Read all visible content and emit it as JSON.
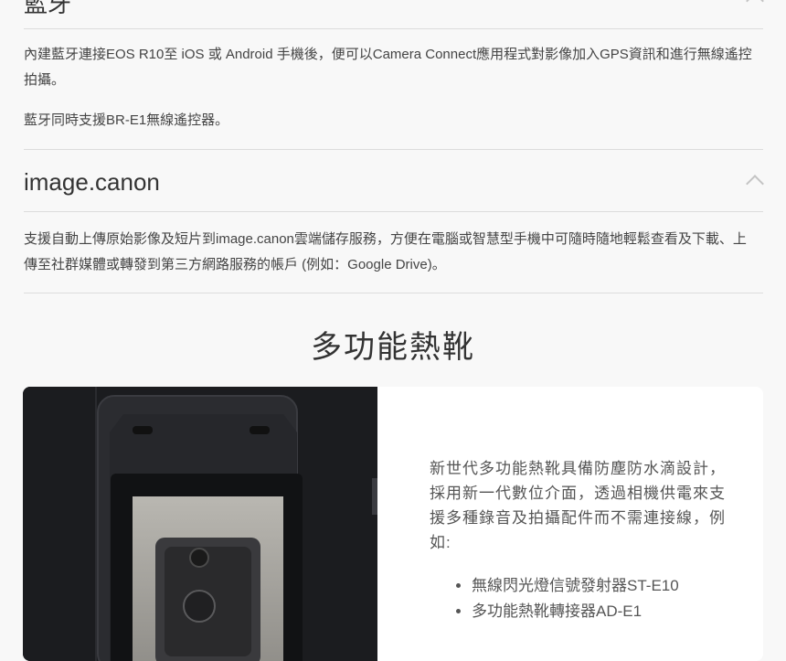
{
  "accordion": [
    {
      "title": "藍牙",
      "paragraphs": [
        "內建藍牙連接EOS R10至 iOS 或 Android 手機後，便可以Camera Connect應用程式對影像加入GPS資訊和進行無線遙控拍攝。",
        "藍牙同時支援BR-E1無線遙控器。"
      ]
    },
    {
      "title": "image.canon",
      "paragraphs": [
        "支援自動上傳原始影像及短片到image.canon雲端儲存服務，方便在電腦或智慧型手機中可隨時隨地輕鬆查看及下載、上傳至社群媒體或轉發到第三方網路服務的帳戶 (例如：Google Drive)。"
      ]
    }
  ],
  "section": {
    "title": "多功能熱靴",
    "description": "新世代多功能熱靴具備防塵防水滴設計，採用新一代數位介面，透過相機供電來支援多種錄音及拍攝配件而不需連接線，例如:",
    "list": [
      "無線閃光燈信號發射器ST-E10",
      "多功能熱靴轉接器AD-E1"
    ]
  }
}
